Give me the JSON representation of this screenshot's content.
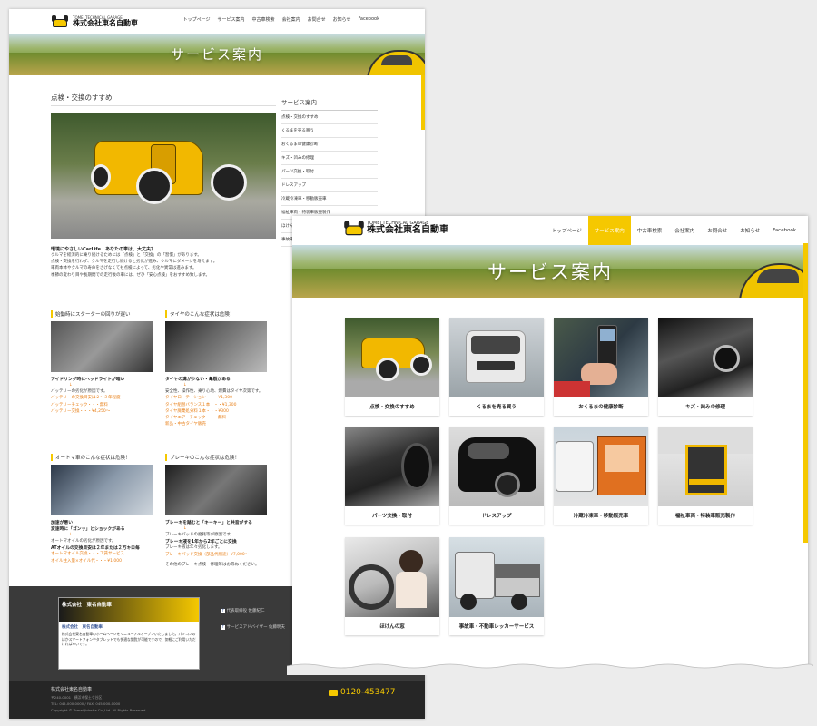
{
  "company": {
    "tagline": "TOMEI TECHNICAL GARAGE",
    "name": "株式会社東名自動車"
  },
  "nav": {
    "items": [
      "トップページ",
      "サービス案内",
      "中古車検索",
      "会社案内",
      "お問合せ",
      "お知らせ",
      "Facebook"
    ],
    "active": "サービス案内"
  },
  "hero": {
    "title": "サービス案内"
  },
  "article": {
    "heading": "点検・交換のすすめ",
    "lead_title": "環境にやさしいCarLife　あなたの車は、大丈夫？",
    "lead_lines": [
      "クルマを経済的に乗り続けるためには「点検」と「交換」の「習慣」があります。",
      "点検・交換を行わず、クルマを走行し続けると劣化が進み、クルマにダメージを与えます。",
      "車両本体やクルマの寿命をさげなくても点検によって、劣化や異常は進みます。",
      "季節の変わり目や長期間での走行後の車には、ぜひ「安心点検」をおすすめ致します。"
    ],
    "sections": [
      {
        "title": "始動時にスターターの回りが遅い",
        "lines": [
          "アイドリング時にヘッドライトが暗い",
          "↓",
          "バッテリーの劣化が原因です。"
        ],
        "bullets": [
          "バッテリーの交換目安は２〜３年程度",
          "バッテリーチェック・・・無料",
          "バッテリー交換・・・¥4,250〜"
        ]
      },
      {
        "title": "タイヤのこんな症状は危険！",
        "lines": [
          "タイヤの溝が少ない・亀裂がある",
          "↓",
          "安全性、操作性、乗り心地、燃費はタイヤ次第です。"
        ],
        "bullets": [
          "タイヤローテーション・・・¥1,300",
          "タイヤ組替バランス１本・・・¥1,300",
          "タイヤ廃棄処分料１本・・・¥300",
          "タイヤエアーチェック・・・無料",
          "新品・中古タイヤ販売"
        ]
      },
      {
        "title": "オートマ車のこんな症状は危険！",
        "lines": [
          "加速が悪い",
          "変速時に「ゴンッ」とショックがある",
          "↓",
          "オートマオイルの劣化が原因です。",
          "ATオイルの交換目安は２年または２万キロ毎"
        ],
        "bullets": [
          "オートマオイル交換・・・工賃サービス",
          "オイル注入量×オイル代・・・¥1,000"
        ]
      },
      {
        "title": "ブレーキのこんな症状は危険！",
        "lines": [
          "ブレーキを踏むと「キーキー」と共音がする",
          "↓",
          "ブレーキパッドの磨耗等が原因です。",
          "ブレーキ液を1年から2年ごとに交換",
          "ブレーキ液は年々劣化します。"
        ],
        "bullets": [
          "ブレーキパッド交換（部品代別途）¥7,000〜"
        ],
        "note": "その他のブレーキ点検・修理等はお尋ねください。"
      }
    ]
  },
  "sidebar": {
    "heading": "サービス案内",
    "items": [
      "点検・交換のすすめ",
      "くるまを売る買う",
      "おくるまの健康診断",
      "キズ・凹みの修理",
      "パーツ交換・取付",
      "ドレスアップ",
      "冷蔵冷凍車・移動販売車",
      "福祉車両・特装車販売製作",
      "ほけんの窓",
      "事故車・不動車レッカーサービス"
    ]
  },
  "footer": {
    "fb_box_title": "株式会社　東名自動車",
    "fb_post_name": "株式会社　東名自動車",
    "fb_post_text": "株式会社東名自動車のホームページをリニューアルオープンいたしました。パソコンのほかスマートフォンやタブレットでも快適な閲覧が可能ですので、気軽にご利用いただければ幸いです。",
    "links": [
      "代表取締役 佐藤紀仁",
      "サービスアドバイザー 佐藤明夫"
    ],
    "company": "株式会社東名自動車",
    "address": "〒240-0001　横浜市保土ケ谷区",
    "tel": "TEL: 045-000-0000 / FAX: 045-000-0000",
    "copyright": "Copyright © Tomei Jidosha Co.,Ltd. All Rights Reserved.",
    "phone": "0120-453477"
  },
  "tiles": [
    {
      "label": "点検・交換のすすめ",
      "icon": "yellow-hotrod"
    },
    {
      "label": "くるまを売る買う",
      "icon": "white-minivan"
    },
    {
      "label": "おくるまの健康診断",
      "icon": "diagnostic-tool"
    },
    {
      "label": "キズ・凹みの修理",
      "icon": "black-car-door"
    },
    {
      "label": "パーツ交換・取付",
      "icon": "undercarriage"
    },
    {
      "label": "ドレスアップ",
      "icon": "black-compact-car"
    },
    {
      "label": "冷蔵冷凍車・移動販売車",
      "icon": "food-truck"
    },
    {
      "label": "福祉車両・特装車販売製作",
      "icon": "wheelchair-lift"
    },
    {
      "label": "ほけんの窓",
      "icon": "woman-driving"
    },
    {
      "label": "事故車・不動車レッカーサービス",
      "icon": "tow-truck"
    }
  ],
  "colors": {
    "accent": "#f5c800",
    "link": "#e8801a",
    "footer": "#3a3a3a"
  }
}
